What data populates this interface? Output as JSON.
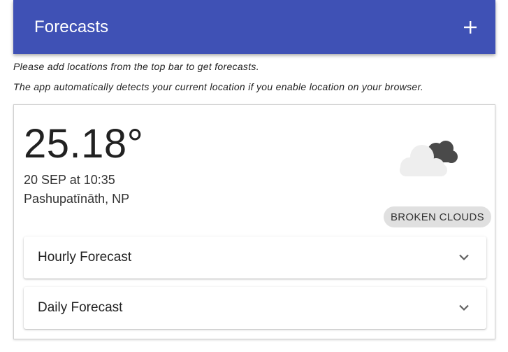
{
  "app_bar": {
    "title": "Forecasts",
    "add_icon": "plus-icon",
    "color": "#3f51b5"
  },
  "notes": {
    "line1": "Please add locations from the top bar to get forecasts.",
    "line2": "The app automatically detects your current location if you enable location on your browser."
  },
  "weather": {
    "temperature": "25.18°",
    "datetime": "20 SEP at 10:35",
    "location": "Pashupatīnāth, NP",
    "condition": "BROKEN CLOUDS",
    "icon": "broken-clouds-icon"
  },
  "panels": {
    "hourly_label": "Hourly Forecast",
    "daily_label": "Daily Forecast",
    "expand_icon": "chevron-down-icon"
  }
}
